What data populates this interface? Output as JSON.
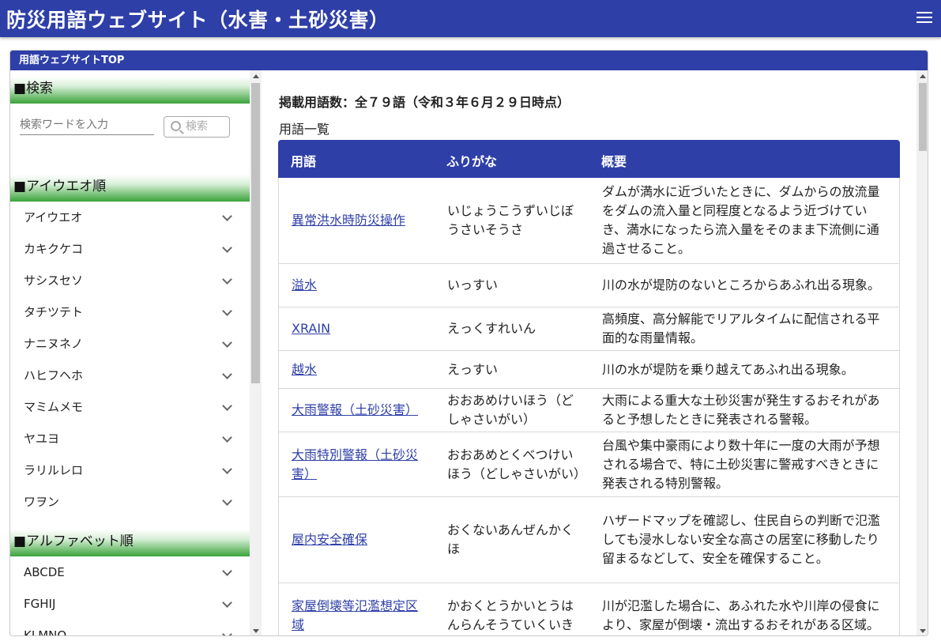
{
  "header": {
    "title": "防災用語ウェブサイト（水害・土砂災害）"
  },
  "nav": {
    "top_label": "用語ウェブサイトTOP"
  },
  "sidebar": {
    "search_heading": "■検索",
    "search_placeholder": "検索ワードを入力",
    "search_button": "検索",
    "kana_heading": "■アイウエオ順",
    "kana_items": [
      "アイウエオ",
      "カキクケコ",
      "サシスセソ",
      "タチツテト",
      "ナニヌネノ",
      "ハヒフヘホ",
      "マミムメモ",
      "ヤユヨ",
      "ラリルレロ",
      "ワヲン"
    ],
    "alpha_heading": "■アルファベット順",
    "alpha_items": [
      "ABCDE",
      "FGHIJ",
      "KLMNO"
    ]
  },
  "main": {
    "count_text": "掲載用語数：全７９語（令和３年６月２９日時点）",
    "list_label": "用語一覧",
    "columns": [
      "用語",
      "ふりがな",
      "概要"
    ],
    "rows": [
      {
        "term": "異常洪水時防災操作",
        "reading": "いじょうこうずいじぼうさいそうさ",
        "summary": "ダムが満水に近づいたときに、ダムからの放流量をダムの流入量と同程度となるよう近づけていき、満水になったら流入量をそのまま下流側に通過させること。"
      },
      {
        "term": "溢水",
        "reading": "いっすい",
        "summary": "川の水が堤防のないところからあふれ出る現象。"
      },
      {
        "term": "XRAIN",
        "reading": "えっくすれいん",
        "summary": "高頻度、高分解能でリアルタイムに配信される平面的な雨量情報。"
      },
      {
        "term": "越水",
        "reading": "えっすい",
        "summary": "川の水が堤防を乗り越えてあふれ出る現象。"
      },
      {
        "term": "大雨警報（土砂災害）",
        "reading": "おおあめけいほう（どしゃさいがい）",
        "summary": "大雨による重大な土砂災害が発生するおそれがあると予想したときに発表される警報。"
      },
      {
        "term": "大雨特別警報（土砂災害）",
        "reading": "おおあめとくべつけいほう（どしゃさいがい）",
        "summary": "台風や集中豪雨により数十年に一度の大雨が予想される場合で、特に土砂災害に警戒すべきときに発表される特別警報。"
      },
      {
        "term": "屋内安全確保",
        "reading": "おくないあんぜんかくほ",
        "summary": "ハザードマップを確認し、住民自らの判断で氾濫しても浸水しない安全な高さの居室に移動したり留まるなどして、安全を確保すること。"
      },
      {
        "term": "家屋倒壊等氾濫想定区域",
        "reading": "かおくとうかいとうはんらんそうていくいき",
        "summary": "川が氾濫した場合に、あふれた水や川岸の侵食により、家屋が倒壊・流出するおそれがある区域。"
      }
    ]
  }
}
